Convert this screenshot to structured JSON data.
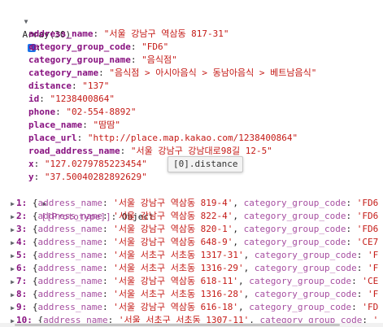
{
  "header": {
    "label": "Array(30)",
    "info_icon": "i"
  },
  "item0": {
    "index": "0",
    "fields": [
      {
        "key": "address_name",
        "value": "\"서울 강남구 역삼동 817-31\""
      },
      {
        "key": "category_group_code",
        "value": "\"FD6\""
      },
      {
        "key": "category_group_name",
        "value": "\"음식점\""
      },
      {
        "key": "category_name",
        "value": "\"음식점 > 아시아음식 > 동남아음식 > 베트남음식\""
      },
      {
        "key": "distance",
        "value": "\"137\""
      },
      {
        "key": "id",
        "value": "\"1238400864\""
      },
      {
        "key": "phone",
        "value": "\"02-554-8892\""
      },
      {
        "key": "place_name",
        "value": "\"땀땀\""
      },
      {
        "key": "place_url",
        "value": "\"http://place.map.kakao.com/1238400864\""
      },
      {
        "key": "road_address_name",
        "value": "\"서울 강남구 강남대로98길 12-5\""
      },
      {
        "key": "x",
        "value": "\"127.0279785223454\""
      },
      {
        "key": "y",
        "value": "\"37.50040282892629\""
      }
    ],
    "prototype_key": "[[Prototype]]",
    "prototype_value": "Object"
  },
  "tooltip": "[0].distance",
  "rows": [
    {
      "index": "1:",
      "address": "'서울 강남구 역삼동 819-4'",
      "code": "'FD6"
    },
    {
      "index": "2:",
      "address": "'서울 강남구 역삼동 822-4'",
      "code": "'FD6"
    },
    {
      "index": "3:",
      "address": "'서울 강남구 역삼동 820-1'",
      "code": "'FD6"
    },
    {
      "index": "4:",
      "address": "'서울 강남구 역삼동 648-9'",
      "code": "'CE7"
    },
    {
      "index": "5:",
      "address": "'서울 서초구 서초동 1317-31'",
      "code": "'F"
    },
    {
      "index": "6:",
      "address": "'서울 서초구 서초동 1316-29'",
      "code": "'F"
    },
    {
      "index": "7:",
      "address": "'서울 강남구 역삼동 618-11'",
      "code": "'CE"
    },
    {
      "index": "8:",
      "address": "'서울 서초구 서초동 1316-28'",
      "code": "'F"
    },
    {
      "index": "9:",
      "address": "'서울 강남구 역삼동 616-18'",
      "code": "'FD"
    },
    {
      "index": "10:",
      "address": "'서울 서초구 서초동 1307-11'",
      "code": "'"
    }
  ],
  "labels": {
    "open_brace": "{",
    "address_key": "address_name",
    "code_key": "category_group_code",
    "colon": ":",
    "comma": ","
  }
}
